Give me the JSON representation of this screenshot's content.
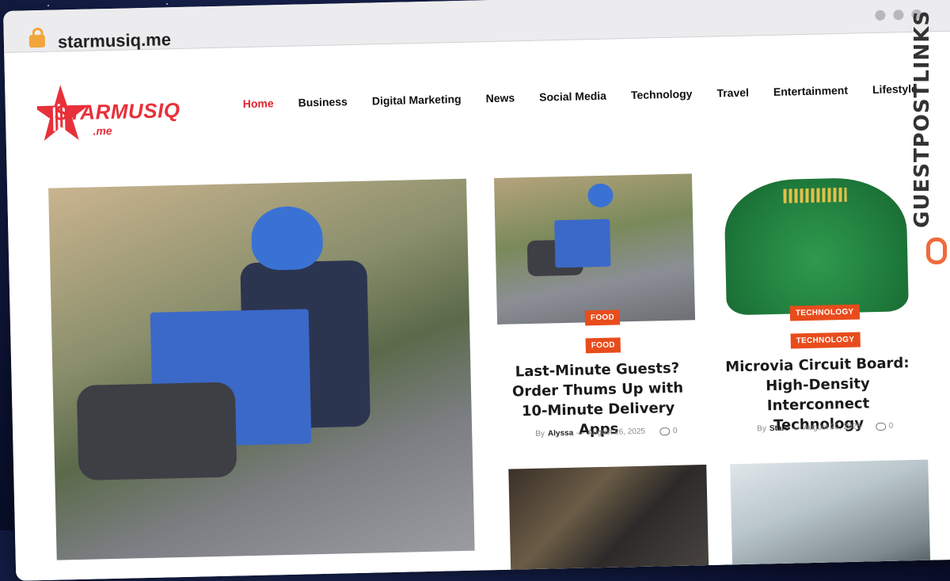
{
  "browser": {
    "url": "starmusiq.me"
  },
  "logo": {
    "word": "STARMUSIQ",
    "sub": ".me"
  },
  "nav": [
    "Home",
    "Business",
    "Digital Marketing",
    "News",
    "Social Media",
    "Technology",
    "Travel",
    "Entertainment",
    "Lifestyle"
  ],
  "cards": [
    {
      "category": "FOOD",
      "title": "Last-Minute Guests? Order Thums Up with 10-Minute Delivery Apps",
      "by": "By",
      "author": "Alyssa",
      "date": "August 26, 2025",
      "comments": "0"
    },
    {
      "category": "TECHNOLOGY",
      "title": "Microvia Circuit Board: High-Density Interconnect Technology",
      "by": "By",
      "author": "Starc",
      "date": "August 20, 2025",
      "comments": "0"
    }
  ],
  "side_brand": "GUESTPOSTLINKS",
  "colors": {
    "accent": "#e3262f",
    "tag": "#e84c1c",
    "brand_link": "#f06a3a"
  }
}
